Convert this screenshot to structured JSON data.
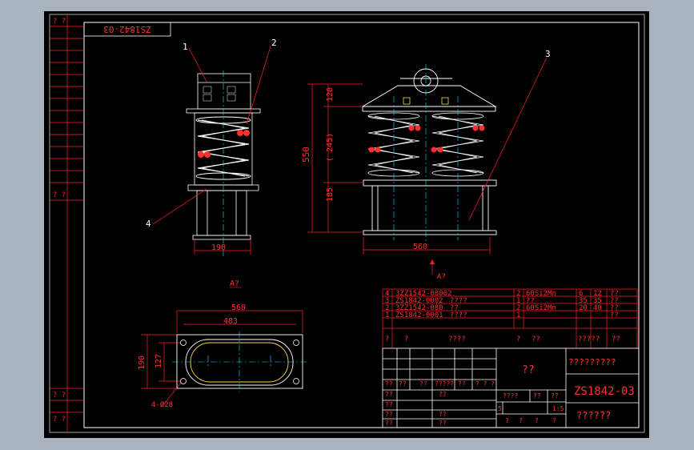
{
  "drawing_number": "ZS1842-03",
  "mirrored_number": "ZS1842-03",
  "balloons": {
    "one": "1",
    "two": "2",
    "three": "3",
    "four": "4"
  },
  "dimensions": {
    "left_width": "190",
    "overall_height": "550",
    "top_part": "120",
    "middle_part": "( 245)",
    "bottom_part": "185",
    "front_width": "560",
    "plan_width": "560",
    "plan_inner_width": "483",
    "plan_height": "190",
    "plan_inner_height": "127",
    "holes": "4-Ø28"
  },
  "view_arrow": "A?",
  "view_label": "A?",
  "left_strip": {
    "top": "?  ?",
    "mid": "?  ?",
    "bot1": "? ?",
    "bot2": "? ?"
  },
  "parts_list": [
    {
      "no": "4",
      "code": "3ZZ1542-08002",
      "name": "",
      "qty": "2",
      "mat": "60Si2Mn",
      "a": "6",
      "b": "12",
      "c": "??"
    },
    {
      "no": "3",
      "code": "ZS1842-0002",
      "name": "????",
      "qty": "1",
      "mat": "??",
      "a": "35",
      "b": "35",
      "c": "??"
    },
    {
      "no": "2",
      "code": "3ZZ1542-080",
      "name": "??",
      "qty": "2",
      "mat": "60Si2Mn",
      "a": "20",
      "b": "40",
      "c": "??"
    },
    {
      "no": "1",
      "code": "ZS1842-0001",
      "name": "????",
      "qty": "1",
      "mat": "",
      "a": "",
      "b": "",
      "c": "??"
    }
  ],
  "list_header": [
    "?",
    "?",
    "????",
    "?",
    "??",
    "????",
    "?",
    "??"
  ],
  "title_block": {
    "name": "??",
    "company": "?????????",
    "number": "ZS1842-03",
    "bottom": "??????",
    "scale": "1:5",
    "sheet": "5",
    "rows": [
      [
        "??",
        "??",
        "??",
        "?????",
        "??",
        "? ? ?"
      ],
      [
        "??",
        "",
        "??",
        "",
        "",
        ""
      ],
      [
        "??",
        "",
        "",
        "????",
        "??",
        "??"
      ],
      [
        "??",
        "",
        "??",
        "",
        "",
        ""
      ],
      [
        "??",
        "",
        "??",
        "",
        "",
        ""
      ]
    ],
    "stage": [
      "?",
      "?",
      "?",
      "?"
    ]
  }
}
